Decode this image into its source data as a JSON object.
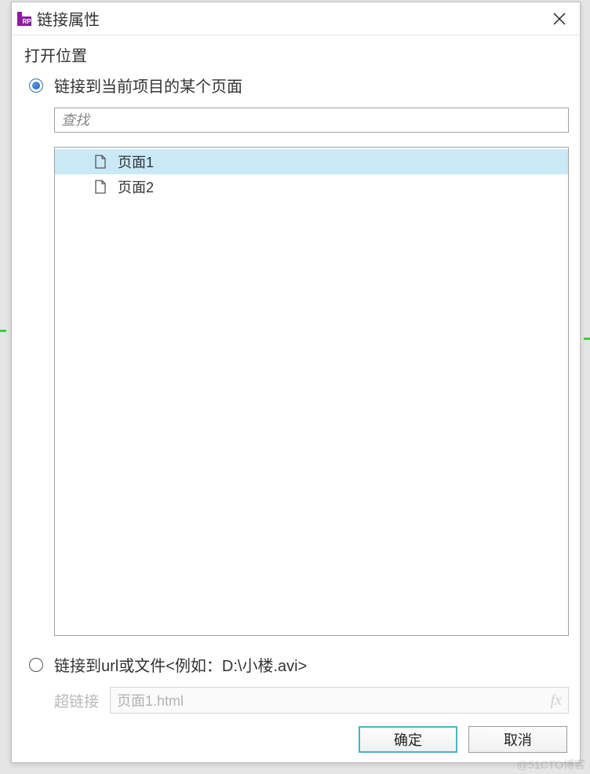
{
  "dialog": {
    "title": "链接属性",
    "section_label": "打开位置",
    "radio_link_page": "链接到当前项目的某个页面",
    "search_placeholder": "查找",
    "pages": [
      {
        "label": "页面1",
        "selected": true
      },
      {
        "label": "页面2",
        "selected": false
      }
    ],
    "radio_link_url": "链接到url或文件<例如：D:\\小楼.avi>",
    "hyperlink_label": "超链接",
    "hyperlink_value": "页面1.html",
    "fx": "fx",
    "ok": "确定",
    "cancel": "取消"
  },
  "watermark": "@51CTO博客"
}
